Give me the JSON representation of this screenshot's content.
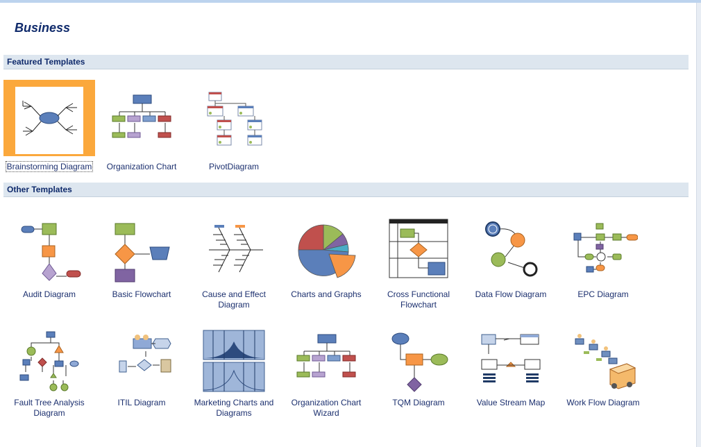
{
  "page": {
    "title": "Business"
  },
  "sections": {
    "featured": "Featured Templates",
    "other": "Other Templates"
  },
  "featured": [
    {
      "label": "Brainstorming Diagram",
      "icon": "brainstorming-diagram-icon",
      "selected": true
    },
    {
      "label": "Organization Chart",
      "icon": "organization-chart-icon"
    },
    {
      "label": "PivotDiagram",
      "icon": "pivot-diagram-icon"
    }
  ],
  "other_row1": [
    {
      "label": "Audit Diagram",
      "icon": "audit-diagram-icon"
    },
    {
      "label": "Basic Flowchart",
      "icon": "basic-flowchart-icon"
    },
    {
      "label_line1": "Cause and Effect",
      "label_line2": "Diagram",
      "icon": "cause-effect-diagram-icon"
    },
    {
      "label": "Charts and Graphs",
      "icon": "charts-graphs-icon"
    },
    {
      "label_line1": "Cross Functional",
      "label_line2": "Flowchart",
      "icon": "cross-functional-flowchart-icon"
    },
    {
      "label": "Data Flow Diagram",
      "icon": "data-flow-diagram-icon"
    },
    {
      "label": "EPC Diagram",
      "icon": "epc-diagram-icon"
    }
  ],
  "other_row2": [
    {
      "label_line1": "Fault Tree Analysis",
      "label_line2": "Diagram",
      "icon": "fault-tree-icon"
    },
    {
      "label": "ITIL Diagram",
      "icon": "itil-diagram-icon"
    },
    {
      "label_line1": "Marketing Charts and",
      "label_line2": "Diagrams",
      "icon": "marketing-charts-icon"
    },
    {
      "label_line1": "Organization Chart",
      "label_line2": "Wizard",
      "icon": "organization-chart-wizard-icon"
    },
    {
      "label": "TQM Diagram",
      "icon": "tqm-diagram-icon"
    },
    {
      "label": "Value Stream Map",
      "icon": "value-stream-map-icon"
    },
    {
      "label": "Work Flow Diagram",
      "icon": "work-flow-diagram-icon"
    }
  ],
  "colors": {
    "selection": "#fba83c",
    "section_bg": "#dde6ef",
    "title_text": "#0f2a6b"
  }
}
